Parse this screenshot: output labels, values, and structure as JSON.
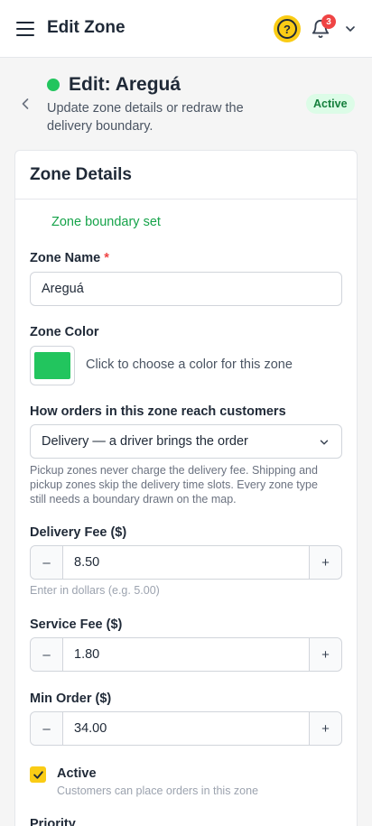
{
  "topbar": {
    "title": "Edit Zone",
    "help_icon_glyph": "?",
    "notification_count": "3"
  },
  "header": {
    "title": "Edit: Areguá",
    "subtitle": "Update zone details or redraw the delivery boundary.",
    "status_badge": "Active",
    "status_color": "#22c55e"
  },
  "card": {
    "title": "Zone Details",
    "boundary_status": "Zone boundary set",
    "zone_name": {
      "label": "Zone Name",
      "required_mark": "*",
      "value": "Areguá"
    },
    "zone_color": {
      "label": "Zone Color",
      "value": "#22c55e",
      "hint": "Click to choose a color for this zone"
    },
    "reach": {
      "label": "How orders in this zone reach customers",
      "selected": "Delivery — a driver brings the order",
      "help": "Pickup zones never charge the delivery fee. Shipping and pickup zones skip the delivery time slots. Every zone type still needs a boundary drawn on the map."
    },
    "delivery_fee": {
      "label": "Delivery Fee ($)",
      "value": "8.50",
      "help": "Enter in dollars (e.g. 5.00)",
      "minus": "–",
      "plus": "+"
    },
    "service_fee": {
      "label": "Service Fee ($)",
      "value": "1.80",
      "minus": "–",
      "plus": "+"
    },
    "min_order": {
      "label": "Min Order ($)",
      "value": "34.00",
      "minus": "–",
      "plus": "+"
    },
    "active": {
      "label": "Active",
      "description": "Customers can place orders in this zone",
      "checked": true
    },
    "priority": {
      "label": "Priority"
    }
  },
  "colors": {
    "accent": "#facc15",
    "success": "#22c55e",
    "danger": "#ef4444"
  }
}
